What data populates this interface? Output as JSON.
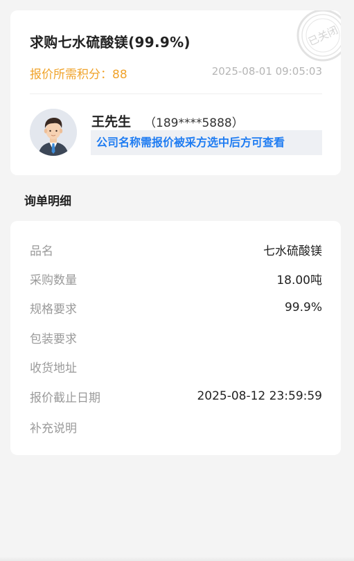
{
  "header": {
    "title": "求购七水硫酸镁(99.9%)",
    "points_label": "报价所需积分：",
    "points_value": "88",
    "timestamp": "2025-08-01 09:05:03",
    "stamp_text": "已关闭"
  },
  "contact": {
    "name": "王先生",
    "phone": "（189****5888）",
    "company_notice": "公司名称需报价被采方选中后方可查看"
  },
  "details": {
    "section_title": "询单明细",
    "rows": [
      {
        "label": "品名",
        "value": "七水硫酸镁"
      },
      {
        "label": "采购数量",
        "value": "18.00吨"
      },
      {
        "label": "规格要求",
        "value": "99.9%"
      },
      {
        "label": "包装要求",
        "value": ""
      },
      {
        "label": "收货地址",
        "value": ""
      },
      {
        "label": "报价截止日期",
        "value": "2025-08-12 23:59:59"
      },
      {
        "label": "补充说明",
        "value": ""
      }
    ]
  },
  "colors": {
    "accent_orange": "#f0a32b",
    "notice_blue": "#1f7cf2",
    "background": "#f4f4f4"
  }
}
